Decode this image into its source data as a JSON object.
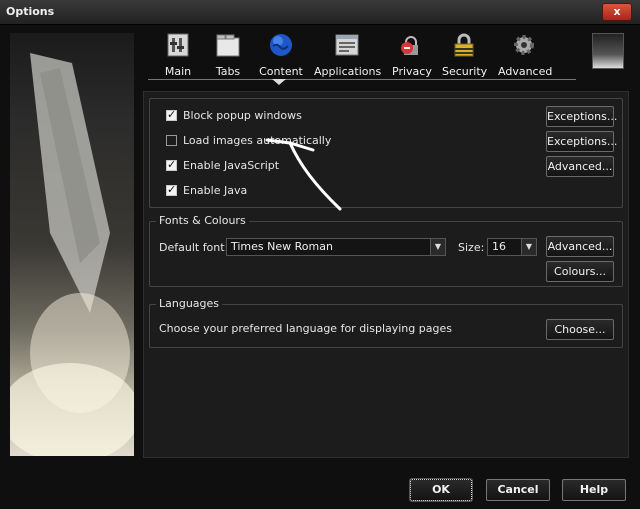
{
  "window": {
    "title": "Options",
    "close_label": "x"
  },
  "toolbar": {
    "tabs": [
      {
        "label": "Main",
        "icon": "main-icon"
      },
      {
        "label": "Tabs",
        "icon": "tabs-icon"
      },
      {
        "label": "Content",
        "icon": "globe-icon",
        "selected": true
      },
      {
        "label": "Applications",
        "icon": "applications-icon"
      },
      {
        "label": "Privacy",
        "icon": "privacy-icon"
      },
      {
        "label": "Security",
        "icon": "lock-icon"
      },
      {
        "label": "Advanced",
        "icon": "gear-icon"
      }
    ]
  },
  "content": {
    "checkboxes": [
      {
        "label": "Block popup windows",
        "checked": true,
        "button": "Exceptions..."
      },
      {
        "label": "Load images automatically",
        "checked": false,
        "button": "Exceptions..."
      },
      {
        "label": "Enable JavaScript",
        "checked": true,
        "button": "Advanced..."
      },
      {
        "label": "Enable Java",
        "checked": true
      }
    ],
    "fonts": {
      "title": "Fonts & Colours",
      "default_font_label": "Default font:",
      "default_font_value": "Times New Roman",
      "size_label": "Size:",
      "size_value": "16",
      "advanced_button": "Advanced...",
      "colours_button": "Colours..."
    },
    "languages": {
      "title": "Languages",
      "description": "Choose your preferred language for displaying pages",
      "choose_button": "Choose..."
    }
  },
  "footer": {
    "ok": "OK",
    "cancel": "Cancel",
    "help": "Help"
  },
  "colors": {
    "background": "#0f0f0f",
    "panel": "#1c1c1c",
    "close_button": "#c23a26",
    "globe": "#1f57c8"
  }
}
